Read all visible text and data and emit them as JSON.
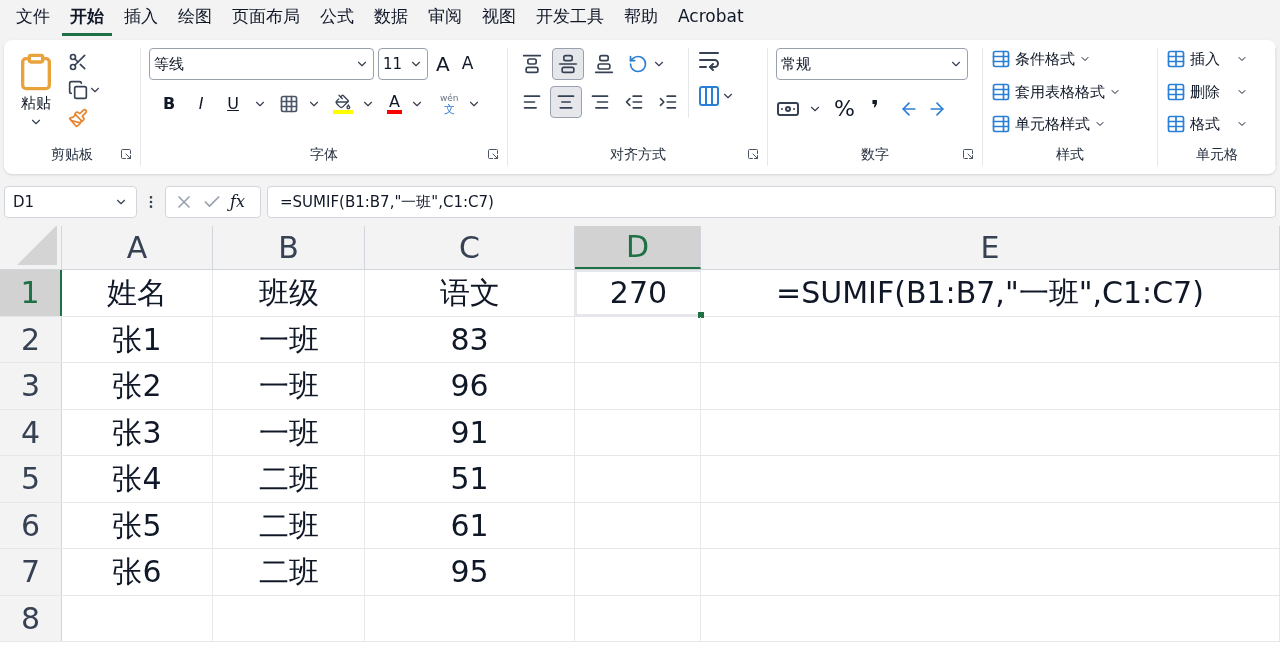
{
  "menu_tabs": [
    {
      "label": "文件",
      "selected": false
    },
    {
      "label": "开始",
      "selected": true
    },
    {
      "label": "插入",
      "selected": false
    },
    {
      "label": "绘图",
      "selected": false
    },
    {
      "label": "页面布局",
      "selected": false
    },
    {
      "label": "公式",
      "selected": false
    },
    {
      "label": "数据",
      "selected": false
    },
    {
      "label": "审阅",
      "selected": false
    },
    {
      "label": "视图",
      "selected": false
    },
    {
      "label": "开发工具",
      "selected": false
    },
    {
      "label": "帮助",
      "selected": false
    },
    {
      "label": "Acrobat",
      "selected": false
    }
  ],
  "ribbon": {
    "clipboard": {
      "paste": "粘贴",
      "label": "剪贴板"
    },
    "font": {
      "family": "等线",
      "size": "11",
      "bold": "B",
      "italic": "I",
      "underline": "U",
      "font_color": "A",
      "grow": "A",
      "shrink": "A",
      "phonetic_top": "wén",
      "phonetic_bottom": "文",
      "label": "字体"
    },
    "alignment": {
      "top_row": [
        {
          "kind": "top",
          "selected": false
        },
        {
          "kind": "middle",
          "selected": true
        },
        {
          "kind": "bottom",
          "selected": false
        }
      ],
      "bottom_row": [
        {
          "kind": "left",
          "selected": false
        },
        {
          "kind": "center",
          "selected": true
        },
        {
          "kind": "right",
          "selected": false
        },
        {
          "kind": "outdent",
          "selected": false
        },
        {
          "kind": "indent",
          "selected": false
        }
      ],
      "label": "对齐方式"
    },
    "number": {
      "format": "常规",
      "percent": "%",
      "comma": "❜",
      "label": "数字"
    },
    "styles": {
      "items": [
        "条件格式",
        "套用表格格式",
        "单元格样式"
      ],
      "label": "样式"
    },
    "cells": {
      "items": [
        "插入",
        "删除",
        "格式"
      ],
      "label": "单元格"
    }
  },
  "name_box": "D1",
  "function_button": "ƒx",
  "formula": "=SUMIF(B1:B7,\"一班\",C1:C7)",
  "columns": [
    {
      "label": "A",
      "selected": false
    },
    {
      "label": "B",
      "selected": false
    },
    {
      "label": "C",
      "selected": false
    },
    {
      "label": "D",
      "selected": true
    },
    {
      "label": "E",
      "selected": false
    }
  ],
  "rows": [
    {
      "number": "1",
      "selected": true,
      "cells": [
        "姓名",
        "班级",
        "语文",
        "270",
        "=SUMIF(B1:B7,\"一班\",C1:C7)"
      ]
    },
    {
      "number": "2",
      "selected": false,
      "cells": [
        "张1",
        "一班",
        "83",
        "",
        ""
      ]
    },
    {
      "number": "3",
      "selected": false,
      "cells": [
        "张2",
        "一班",
        "96",
        "",
        ""
      ]
    },
    {
      "number": "4",
      "selected": false,
      "cells": [
        "张3",
        "一班",
        "91",
        "",
        ""
      ]
    },
    {
      "number": "5",
      "selected": false,
      "cells": [
        "张4",
        "二班",
        "51",
        "",
        ""
      ]
    },
    {
      "number": "6",
      "selected": false,
      "cells": [
        "张5",
        "二班",
        "61",
        "",
        ""
      ]
    },
    {
      "number": "7",
      "selected": false,
      "cells": [
        "张6",
        "二班",
        "95",
        "",
        ""
      ]
    },
    {
      "number": "8",
      "selected": false,
      "cells": [
        "",
        "",
        "",
        "",
        ""
      ]
    }
  ]
}
